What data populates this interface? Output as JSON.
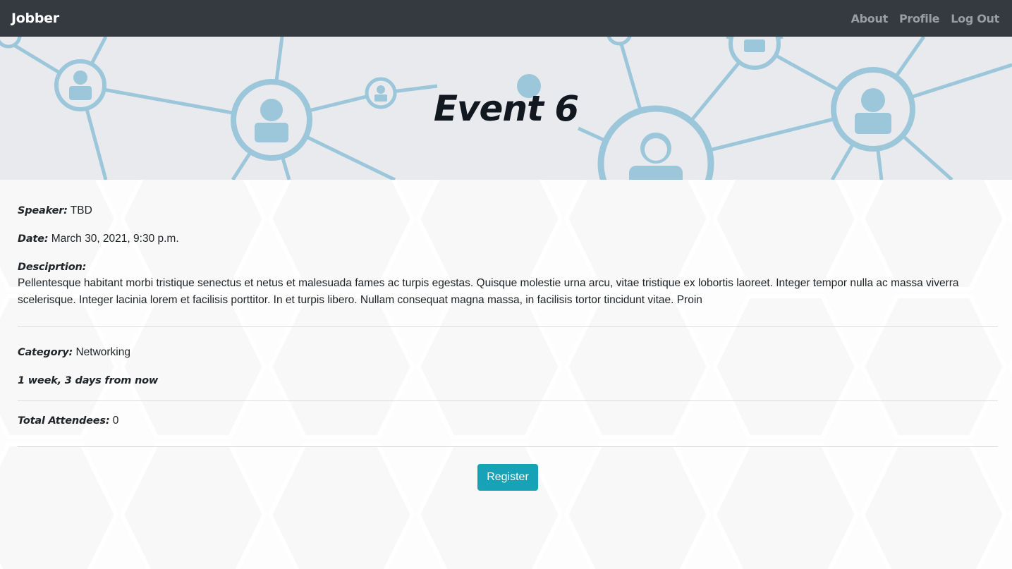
{
  "navbar": {
    "brand": "Jobber",
    "links": [
      "About",
      "Profile",
      "Log Out"
    ]
  },
  "hero": {
    "title": "Event 6"
  },
  "event": {
    "speaker_label": "Speaker:",
    "speaker": "TBD",
    "date_label": "Date:",
    "date": "March 30, 2021, 9:30 p.m.",
    "description_label": "Desciprtion:",
    "description": "Pellentesque habitant morbi tristique senectus et netus et malesuada fames ac turpis egestas. Quisque molestie urna arcu, vitae tristique ex lobortis laoreet. Integer tempor nulla ac massa viverra scelerisque. Integer lacinia lorem et facilisis porttitor. In et turpis libero. Nullam consequat magna massa, in facilisis tortor tincidunt vitae. Proin",
    "category_label": "Category:",
    "category": "Networking",
    "time_until": "1 week, 3 days from now",
    "attendees_label": "Total Attendees:",
    "attendees": "0"
  },
  "actions": {
    "register_label": "Register"
  },
  "colors": {
    "navbar": "#343a40",
    "button": "#17a2b8",
    "network": "#9cc6da"
  }
}
